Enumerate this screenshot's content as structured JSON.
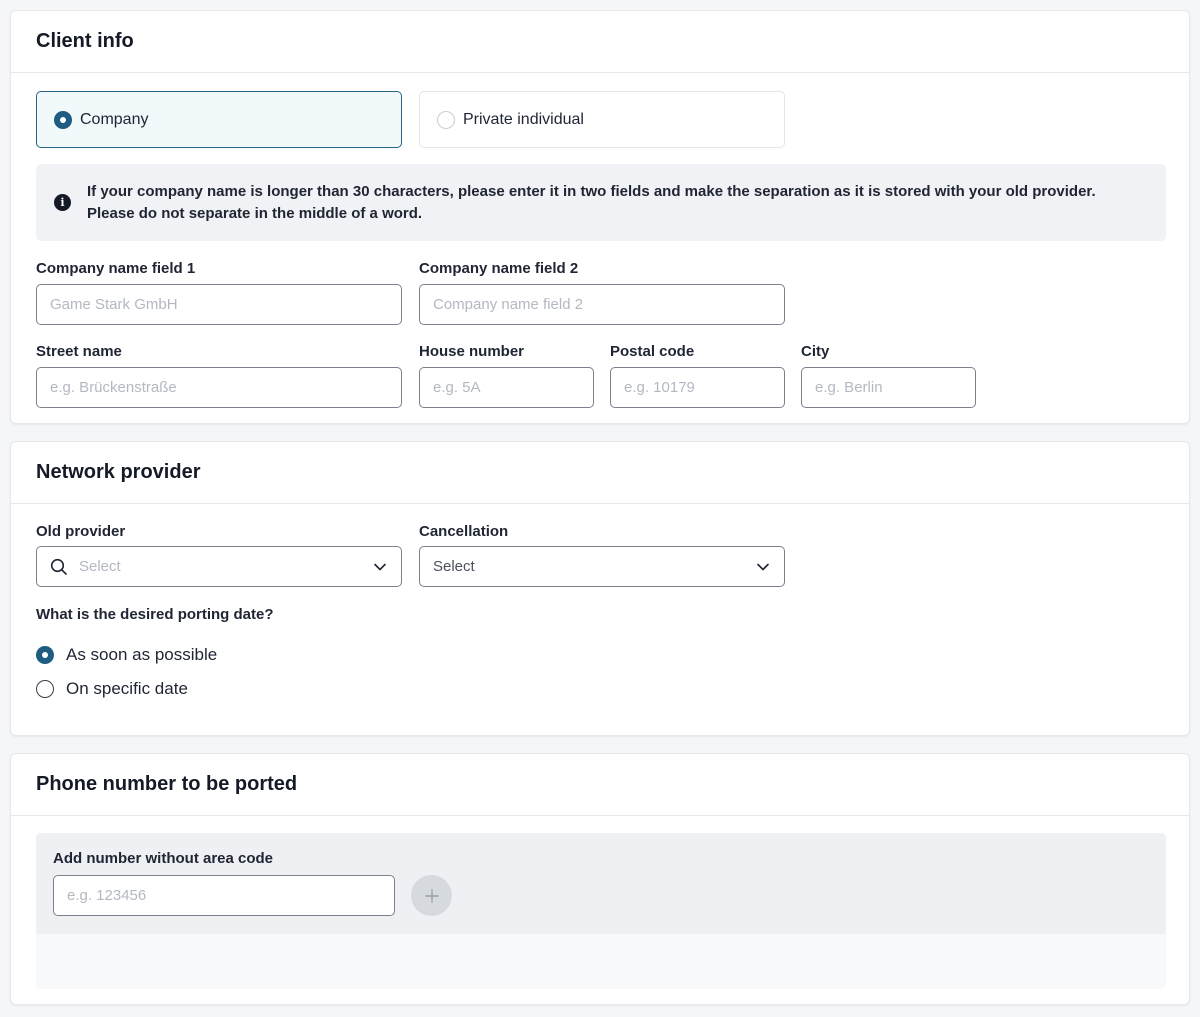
{
  "client_info": {
    "title": "Client info",
    "client_type_options": [
      {
        "label": "Company",
        "selected": true
      },
      {
        "label": "Private individual",
        "selected": false
      }
    ],
    "info_text_line1": "If your company name is longer than 30 characters, please enter it in two fields and make the separation as it is stored with your old provider.",
    "info_text_line2": "Please do not separate in the middle of a word.",
    "company_name_1": {
      "label": "Company name field 1",
      "placeholder": "Game Stark GmbH"
    },
    "company_name_2": {
      "label": "Company name field 2",
      "placeholder": "Company name field 2"
    },
    "street": {
      "label": "Street name",
      "placeholder": "e.g. Brückenstraße"
    },
    "house_number": {
      "label": "House number",
      "placeholder": "e.g. 5A"
    },
    "postal_code": {
      "label": "Postal code",
      "placeholder": "e.g. 10179"
    },
    "city": {
      "label": "City",
      "placeholder": "e.g. Berlin"
    }
  },
  "network_provider": {
    "title": "Network provider",
    "old_provider": {
      "label": "Old provider",
      "placeholder": "Select"
    },
    "cancellation": {
      "label": "Cancellation",
      "value": "Select"
    },
    "porting_question": "What is the desired porting date?",
    "porting_options": [
      {
        "label": "As soon as possible",
        "selected": true
      },
      {
        "label": "On specific date",
        "selected": false
      }
    ]
  },
  "phone_number": {
    "title": "Phone number to be ported",
    "field_label": "Add number without area code",
    "placeholder": "e.g. 123456",
    "add_icon": "plus-icon"
  },
  "colors": {
    "accent": "#1f5c82",
    "selected_bg": "#f1f9fb",
    "info_bg": "#f0f2f5",
    "placeholder": "#b3b8c1"
  }
}
